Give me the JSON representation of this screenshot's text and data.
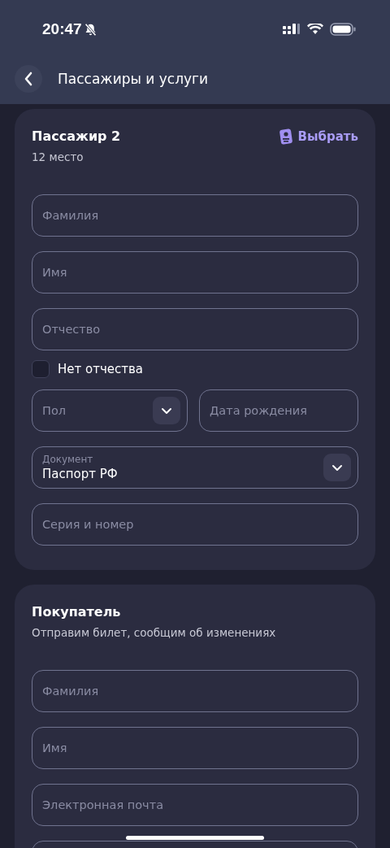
{
  "status_bar": {
    "time": "20:47",
    "silent": true
  },
  "header": {
    "title": "Пассажиры и услуги"
  },
  "passenger": {
    "title": "Пассажир 2",
    "subtitle": "12 место",
    "pick_label": "Выбрать",
    "rows": [
      [
        {
          "kind": "input",
          "placeholder": "Фамилия"
        }
      ],
      [
        {
          "kind": "input",
          "placeholder": "Имя"
        }
      ],
      [
        {
          "kind": "input",
          "placeholder": "Отчество"
        }
      ],
      [
        {
          "kind": "checkbox",
          "label": "Нет отчества",
          "checked": false
        }
      ],
      [
        {
          "kind": "select",
          "placeholder": "Пол"
        },
        {
          "kind": "input",
          "placeholder": "Дата рождения"
        }
      ],
      [
        {
          "kind": "select",
          "label": "Документ",
          "value": "Паспорт РФ"
        }
      ],
      [
        {
          "kind": "input",
          "placeholder": "Серия и номер"
        }
      ]
    ]
  },
  "buyer": {
    "title": "Покупатель",
    "subtitle": "Отправим билет, сообщим об изменениях",
    "rows": [
      [
        {
          "kind": "input",
          "placeholder": "Фамилия"
        }
      ],
      [
        {
          "kind": "input",
          "placeholder": "Имя"
        }
      ],
      [
        {
          "kind": "input",
          "placeholder": "Электронная почта"
        }
      ],
      [
        {
          "kind": "input"
        }
      ]
    ]
  }
}
